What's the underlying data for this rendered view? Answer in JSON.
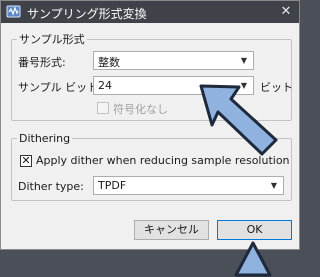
{
  "window": {
    "title": "サンプリング形式変換",
    "close_label": "✕"
  },
  "sampling_group": {
    "legend": "サンプル形式",
    "number_format_label": "番号形式:",
    "number_format_value": "整数",
    "bit_depth_label": "サンプル ビット数:",
    "bit_depth_value": "24",
    "bit_unit": "ビット",
    "signed_label": "符号化なし",
    "signed_checked": false
  },
  "dither_group": {
    "legend": "Dithering",
    "apply_label": "Apply dither when reducing sample resolution",
    "apply_mark": "✕",
    "type_label": "Dither type:",
    "type_value": "TPDF"
  },
  "buttons": {
    "cancel": "キャンセル",
    "ok": "OK"
  },
  "colors": {
    "annotation_arrow": "#8fb2df",
    "annotation_outline": "#1e2a3c"
  }
}
